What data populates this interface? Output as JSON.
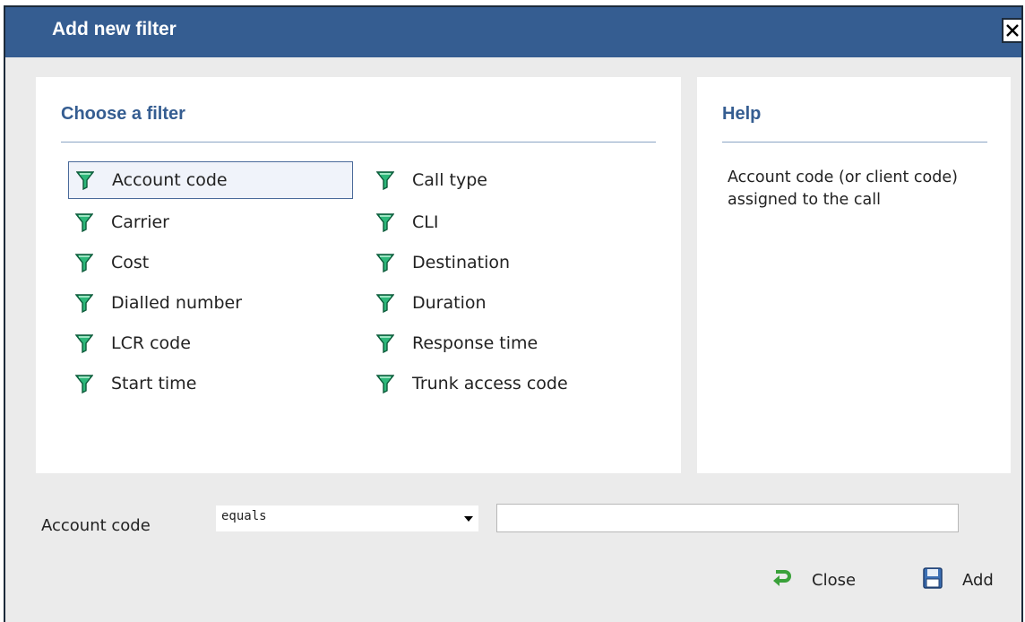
{
  "dialog": {
    "title": "Add new filter",
    "close_icon": "close-x-icon"
  },
  "filters_panel": {
    "heading": "Choose a filter",
    "icon": "filter-funnel-icon",
    "selected": "Account code",
    "items": [
      {
        "label": "Account code"
      },
      {
        "label": "Carrier"
      },
      {
        "label": "Cost"
      },
      {
        "label": "Dialled number"
      },
      {
        "label": "LCR code"
      },
      {
        "label": "Start time"
      },
      {
        "label": "Call type"
      },
      {
        "label": "CLI"
      },
      {
        "label": "Destination"
      },
      {
        "label": "Duration"
      },
      {
        "label": "Response time"
      },
      {
        "label": "Trunk access code"
      }
    ]
  },
  "help_panel": {
    "heading": "Help",
    "text": "Account code (or client code) assigned to the call"
  },
  "criteria": {
    "field_label": "Account code",
    "operator": "equals",
    "value": ""
  },
  "actions": {
    "close_label": "Close",
    "close_icon": "green-return-arrow-icon",
    "add_label": "Add",
    "add_icon": "floppy-disk-icon"
  },
  "colors": {
    "titlebar": "#355d91",
    "heading": "#355d91",
    "dialog_bg": "#ebebeb",
    "funnel": "#2db87a"
  }
}
